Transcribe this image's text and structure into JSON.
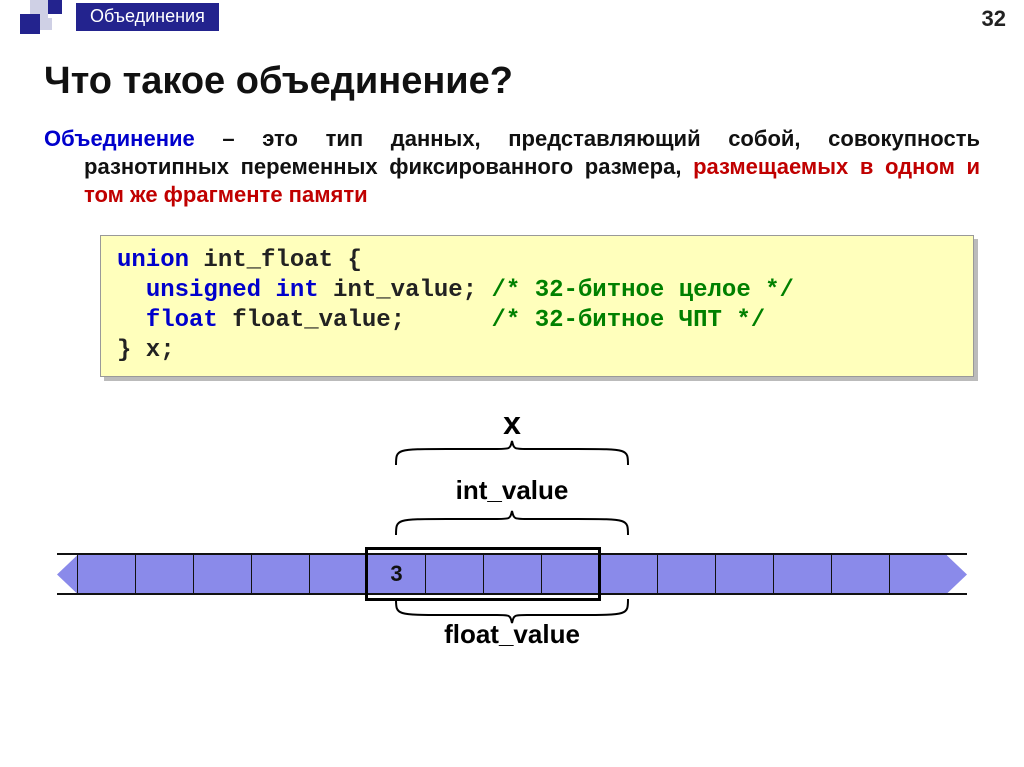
{
  "header": {
    "tab": "Объединения",
    "page": "32"
  },
  "title": "Что такое объединение?",
  "definition": {
    "term": "Объединение",
    "plain1": " – это тип данных, представляющий собой, совокупность разнотипных переменных фиксированного размера, ",
    "highlight": "размещаемых в одном и том же фрагменте памяти"
  },
  "code": {
    "l1_kw": "union",
    "l1_rest": " int_float {",
    "l2_kw1": "unsigned",
    "l2_kw2": "int",
    "l2_rest": " int_value; ",
    "l2_cm": "/* 32-битное целое */",
    "l3_kw": "float",
    "l3_rest": " float_value;      ",
    "l3_cm": "/* 32-битное ЧПТ */",
    "l4": "} x;"
  },
  "diagram": {
    "var": "x",
    "label_top": "int_value",
    "label_bottom": "float_value",
    "cell_value": "3"
  }
}
